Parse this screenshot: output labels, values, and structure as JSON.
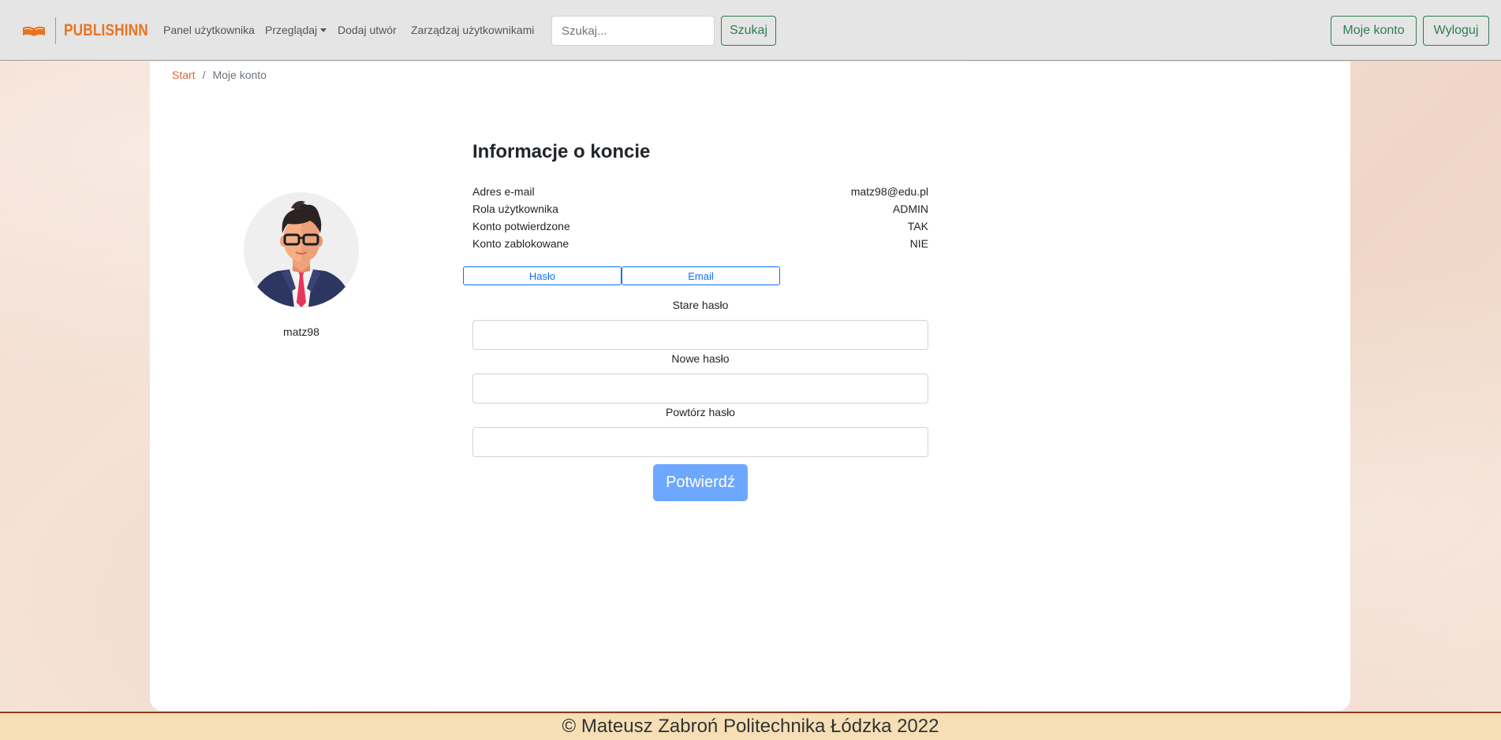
{
  "navbar": {
    "brand": "PUBLISHINN",
    "links": [
      {
        "label": "Panel użytkownika"
      },
      {
        "label": "Przeglądaj"
      },
      {
        "label": "Dodaj utwór"
      },
      {
        "label": "Zarządzaj użytkownikami"
      }
    ],
    "search_placeholder": "Szukaj...",
    "search_button": "Szukaj",
    "account_button": "Moje konto",
    "logout_button": "Wyloguj"
  },
  "breadcrumb": {
    "home": "Start",
    "separator": "/",
    "current": "Moje konto"
  },
  "profile": {
    "username": "matz98",
    "avatar_icon": "businessman-avatar-icon"
  },
  "account_info": {
    "title": "Informacje o koncie",
    "rows": [
      {
        "label": "Adres e-mail",
        "value": "matz98@edu.pl"
      },
      {
        "label": "Rola użytkownika",
        "value": "ADMIN"
      },
      {
        "label": "Konto potwierdzone",
        "value": "TAK"
      },
      {
        "label": "Konto zablokowane",
        "value": "NIE"
      }
    ]
  },
  "tabs": [
    {
      "label": "Hasło"
    },
    {
      "label": "Email"
    }
  ],
  "password_form": {
    "old_password_label": "Stare hasło",
    "new_password_label": "Nowe hasło",
    "repeat_password_label": "Powtórz hasło",
    "submit_label": "Potwierdź"
  },
  "footer": {
    "text": "© Mateusz Zabroń Politechnika Łódzka 2022"
  },
  "colors": {
    "brand": "#e8741f",
    "green_outline": "#2e7d52",
    "primary_blue": "#0d6efd",
    "confirm_button": "#6ea8fe",
    "footer_bg": "#f6dfb5"
  }
}
